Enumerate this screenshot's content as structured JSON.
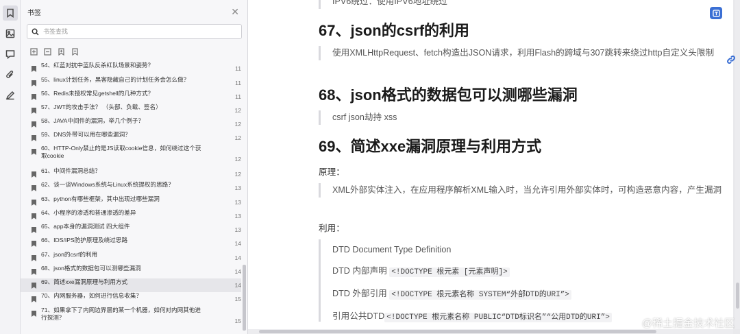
{
  "sidebar": {
    "title": "书签",
    "search_placeholder": "书签查找",
    "items": [
      {
        "label": "54、红蓝对抗中蓝队反杀红队场景和姿势？",
        "page": "11"
      },
      {
        "label": "55、linux计划任务，黑客隐藏自己的计划任务会怎么做？",
        "page": "11"
      },
      {
        "label": "56、Redis未授权常见getshell的几种方式？",
        "page": "11"
      },
      {
        "label": "57、JWT的攻击手法？ （头部、负载、签名）",
        "page": "12"
      },
      {
        "label": "58、JAVA中间件的漏洞，举几个例子？",
        "page": "12"
      },
      {
        "label": "59、DNS外带可以用在哪些漏洞？",
        "page": "12"
      },
      {
        "label": "60、HTTP-Only禁止的是JS读取cookie信息，如何绕过这个获取cookie",
        "page": "12"
      },
      {
        "label": "61、中间件漏洞总结？",
        "page": "12"
      },
      {
        "label": "62、谈一谈Windows系统与Linux系统提权的思路？",
        "page": "13"
      },
      {
        "label": "63、python有哪些框架，其中出现过哪些漏洞",
        "page": "13"
      },
      {
        "label": "64、小程序的渗透和普通渗透的差异",
        "page": "13"
      },
      {
        "label": "65、app本身的漏洞测试 四大组件",
        "page": "13"
      },
      {
        "label": "66、IDS/IPS防护原理及绕过思路",
        "page": "14"
      },
      {
        "label": "67、json的csrf的利用",
        "page": "14"
      },
      {
        "label": "68、json格式的数据包可以测哪些漏洞",
        "page": "14"
      },
      {
        "label": "69、简述xxe漏洞原理与利用方式",
        "page": "14"
      },
      {
        "label": "70、内网服务器，如何进行信息收集？",
        "page": "15"
      },
      {
        "label": "71、如果拿下了内网边界层的某一个机器，如何对内网其他进行探测？",
        "page": "15"
      }
    ]
  },
  "doc": {
    "top_cut_text": "IPV6绕过：使用IPV6地址绕过",
    "h67": "67、json的csrf的利用",
    "q67": "使用XMLHttpRequest、fetch构造出JSON请求，利用Flash的跨域与307跳转来绕过http自定义头限制",
    "h68": "68、json格式的数据包可以测哪些漏洞",
    "q68": "csrf json劫持 xss",
    "h69": "69、简述xxe漏洞原理与利用方式",
    "p_yuanli": "原理：",
    "q69": "XML外部实体注入，在应用程序解析XML输入时，当允许引用外部实体时，可构造恶意内容，产生漏洞",
    "p_liyong": "利用：",
    "dtd_title": "DTD Document Type Definition",
    "dtd_inner_label": "DTD 内部声明",
    "dtd_inner_code": "<!DOCTYPE 根元素 [元素声明]>",
    "dtd_outer_label": "DTD 外部引用",
    "dtd_outer_code": "<!DOCTYPE 根元素名称 SYSTEM“外部DTD的URI”>",
    "dtd_public_label": "引用公共DTD",
    "dtd_public_code": "<!DOCTYPE 根元素名称 PUBLIC“DTD标识名”“公用DTD的URI”>"
  },
  "watermark": "@稀土掘金技术社区"
}
